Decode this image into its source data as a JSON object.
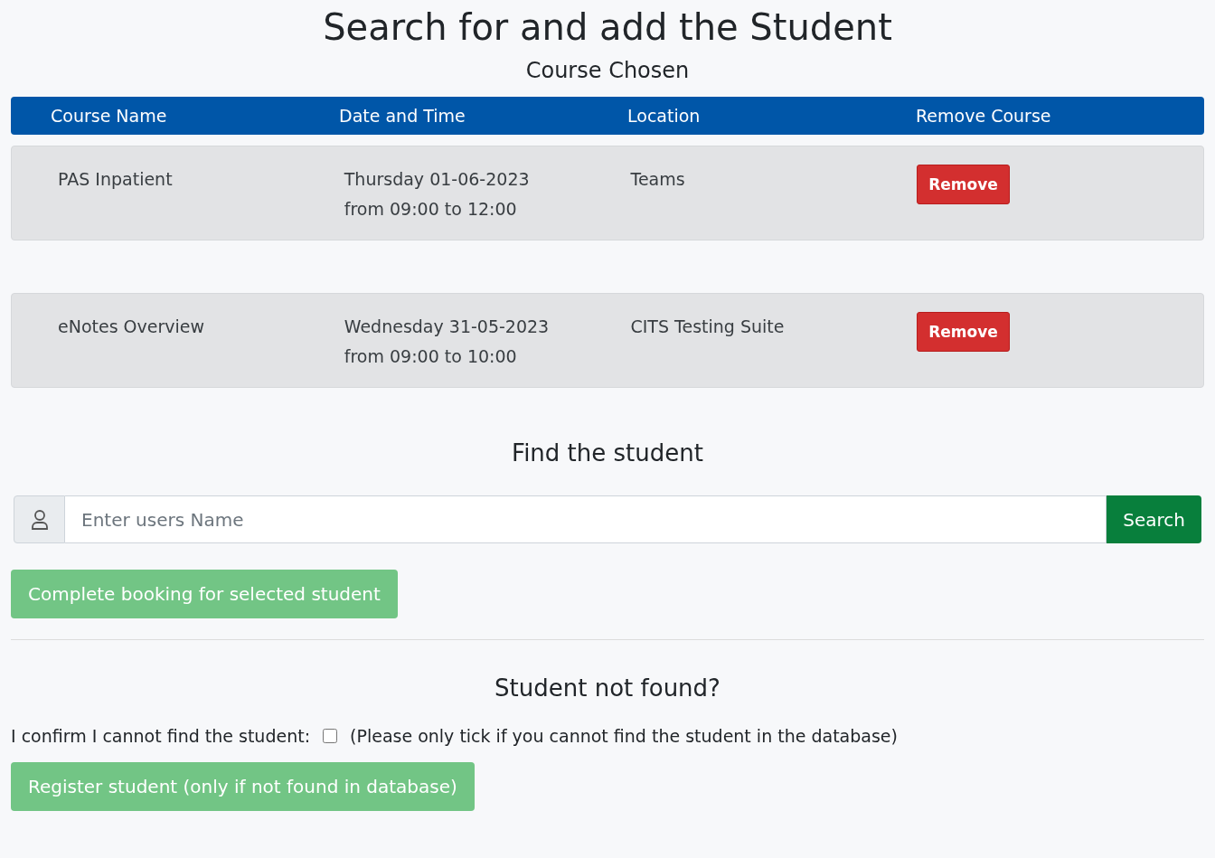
{
  "title": "Search for and add the Student",
  "subtitle": "Course Chosen",
  "table": {
    "columns": [
      "Course Name",
      "Date and Time",
      "Location",
      "Remove Course"
    ],
    "rows": [
      {
        "course": "PAS Inpatient",
        "date": "Thursday 01-06-2023",
        "time": "from 09:00 to 12:00",
        "location": "Teams",
        "action": "Remove"
      },
      {
        "course": "eNotes Overview",
        "date": "Wednesday 31-05-2023",
        "time": "from 09:00 to 10:00",
        "location": "CITS Testing Suite",
        "action": "Remove"
      }
    ]
  },
  "find_heading": "Find the student",
  "search": {
    "placeholder": "Enter users Name",
    "button": "Search"
  },
  "complete_button": {
    "label": "Complete booking for selected student",
    "disabled": true
  },
  "not_found_heading": "Student not found?",
  "confirm": {
    "label": "I confirm I cannot find the student:",
    "checked": false,
    "note": "(Please only tick if you cannot find the student in the database)"
  },
  "register_button": {
    "label": "Register student (only if not found in database)",
    "disabled": true
  }
}
